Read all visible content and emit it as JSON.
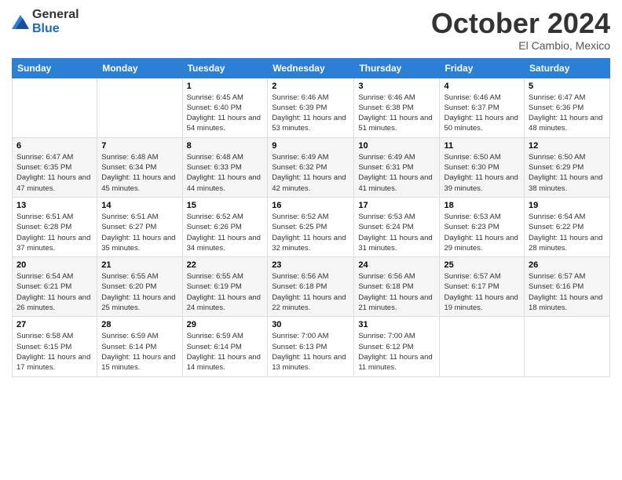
{
  "logo": {
    "general": "General",
    "blue": "Blue"
  },
  "header": {
    "month": "October 2024",
    "location": "El Cambio, Mexico"
  },
  "weekdays": [
    "Sunday",
    "Monday",
    "Tuesday",
    "Wednesday",
    "Thursday",
    "Friday",
    "Saturday"
  ],
  "weeks": [
    [
      {
        "day": "",
        "info": ""
      },
      {
        "day": "",
        "info": ""
      },
      {
        "day": "1",
        "info": "Sunrise: 6:45 AM\nSunset: 6:40 PM\nDaylight: 11 hours and 54 minutes."
      },
      {
        "day": "2",
        "info": "Sunrise: 6:46 AM\nSunset: 6:39 PM\nDaylight: 11 hours and 53 minutes."
      },
      {
        "day": "3",
        "info": "Sunrise: 6:46 AM\nSunset: 6:38 PM\nDaylight: 11 hours and 51 minutes."
      },
      {
        "day": "4",
        "info": "Sunrise: 6:46 AM\nSunset: 6:37 PM\nDaylight: 11 hours and 50 minutes."
      },
      {
        "day": "5",
        "info": "Sunrise: 6:47 AM\nSunset: 6:36 PM\nDaylight: 11 hours and 48 minutes."
      }
    ],
    [
      {
        "day": "6",
        "info": "Sunrise: 6:47 AM\nSunset: 6:35 PM\nDaylight: 11 hours and 47 minutes."
      },
      {
        "day": "7",
        "info": "Sunrise: 6:48 AM\nSunset: 6:34 PM\nDaylight: 11 hours and 45 minutes."
      },
      {
        "day": "8",
        "info": "Sunrise: 6:48 AM\nSunset: 6:33 PM\nDaylight: 11 hours and 44 minutes."
      },
      {
        "day": "9",
        "info": "Sunrise: 6:49 AM\nSunset: 6:32 PM\nDaylight: 11 hours and 42 minutes."
      },
      {
        "day": "10",
        "info": "Sunrise: 6:49 AM\nSunset: 6:31 PM\nDaylight: 11 hours and 41 minutes."
      },
      {
        "day": "11",
        "info": "Sunrise: 6:50 AM\nSunset: 6:30 PM\nDaylight: 11 hours and 39 minutes."
      },
      {
        "day": "12",
        "info": "Sunrise: 6:50 AM\nSunset: 6:29 PM\nDaylight: 11 hours and 38 minutes."
      }
    ],
    [
      {
        "day": "13",
        "info": "Sunrise: 6:51 AM\nSunset: 6:28 PM\nDaylight: 11 hours and 37 minutes."
      },
      {
        "day": "14",
        "info": "Sunrise: 6:51 AM\nSunset: 6:27 PM\nDaylight: 11 hours and 35 minutes."
      },
      {
        "day": "15",
        "info": "Sunrise: 6:52 AM\nSunset: 6:26 PM\nDaylight: 11 hours and 34 minutes."
      },
      {
        "day": "16",
        "info": "Sunrise: 6:52 AM\nSunset: 6:25 PM\nDaylight: 11 hours and 32 minutes."
      },
      {
        "day": "17",
        "info": "Sunrise: 6:53 AM\nSunset: 6:24 PM\nDaylight: 11 hours and 31 minutes."
      },
      {
        "day": "18",
        "info": "Sunrise: 6:53 AM\nSunset: 6:23 PM\nDaylight: 11 hours and 29 minutes."
      },
      {
        "day": "19",
        "info": "Sunrise: 6:54 AM\nSunset: 6:22 PM\nDaylight: 11 hours and 28 minutes."
      }
    ],
    [
      {
        "day": "20",
        "info": "Sunrise: 6:54 AM\nSunset: 6:21 PM\nDaylight: 11 hours and 26 minutes."
      },
      {
        "day": "21",
        "info": "Sunrise: 6:55 AM\nSunset: 6:20 PM\nDaylight: 11 hours and 25 minutes."
      },
      {
        "day": "22",
        "info": "Sunrise: 6:55 AM\nSunset: 6:19 PM\nDaylight: 11 hours and 24 minutes."
      },
      {
        "day": "23",
        "info": "Sunrise: 6:56 AM\nSunset: 6:18 PM\nDaylight: 11 hours and 22 minutes."
      },
      {
        "day": "24",
        "info": "Sunrise: 6:56 AM\nSunset: 6:18 PM\nDaylight: 11 hours and 21 minutes."
      },
      {
        "day": "25",
        "info": "Sunrise: 6:57 AM\nSunset: 6:17 PM\nDaylight: 11 hours and 19 minutes."
      },
      {
        "day": "26",
        "info": "Sunrise: 6:57 AM\nSunset: 6:16 PM\nDaylight: 11 hours and 18 minutes."
      }
    ],
    [
      {
        "day": "27",
        "info": "Sunrise: 6:58 AM\nSunset: 6:15 PM\nDaylight: 11 hours and 17 minutes."
      },
      {
        "day": "28",
        "info": "Sunrise: 6:59 AM\nSunset: 6:14 PM\nDaylight: 11 hours and 15 minutes."
      },
      {
        "day": "29",
        "info": "Sunrise: 6:59 AM\nSunset: 6:14 PM\nDaylight: 11 hours and 14 minutes."
      },
      {
        "day": "30",
        "info": "Sunrise: 7:00 AM\nSunset: 6:13 PM\nDaylight: 11 hours and 13 minutes."
      },
      {
        "day": "31",
        "info": "Sunrise: 7:00 AM\nSunset: 6:12 PM\nDaylight: 11 hours and 11 minutes."
      },
      {
        "day": "",
        "info": ""
      },
      {
        "day": "",
        "info": ""
      }
    ]
  ]
}
